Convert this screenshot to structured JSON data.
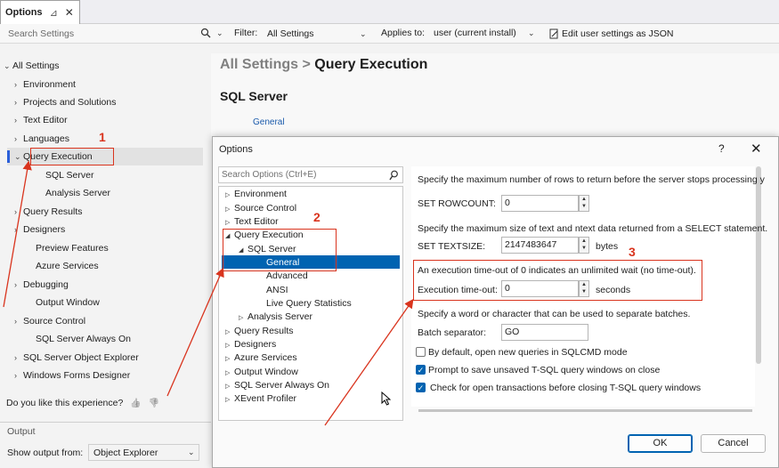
{
  "tab": {
    "title": "Options",
    "pin": "⊿",
    "close": "✕"
  },
  "toolbar": {
    "search_placeholder": "Search Settings",
    "filter_label": "Filter:",
    "filter_value": "All Settings",
    "applies_label": "Applies to:",
    "applies_value": "user (current install)",
    "json_button": "Edit user settings as JSON"
  },
  "left_tree": [
    {
      "label": "All Settings",
      "arrow": "⌄"
    },
    {
      "label": "Environment",
      "arrow": "›"
    },
    {
      "label": "Projects and Solutions",
      "arrow": "›"
    },
    {
      "label": "Text Editor",
      "arrow": "›"
    },
    {
      "label": "Languages",
      "arrow": "›"
    },
    {
      "label": "Query Execution",
      "arrow": "⌄"
    },
    {
      "label": "SQL Server",
      "arrow": ""
    },
    {
      "label": "Analysis Server",
      "arrow": ""
    },
    {
      "label": "Query Results",
      "arrow": "›"
    },
    {
      "label": "Designers",
      "arrow": "›"
    },
    {
      "label": "Preview Features",
      "arrow": ""
    },
    {
      "label": "Azure Services",
      "arrow": ""
    },
    {
      "label": "Debugging",
      "arrow": "›"
    },
    {
      "label": "Output Window",
      "arrow": ""
    },
    {
      "label": "Source Control",
      "arrow": "›"
    },
    {
      "label": "SQL Server Always On",
      "arrow": ""
    },
    {
      "label": "SQL Server Object Explorer",
      "arrow": "›"
    },
    {
      "label": "Windows Forms Designer",
      "arrow": "›"
    }
  ],
  "feedback": {
    "question": "Do you like this experience?",
    "up": "👍",
    "down": "👎"
  },
  "output_panel": {
    "title": "Output",
    "show_from_label": "Show output from:",
    "show_from_value": "Object Explorer"
  },
  "breadcrumb": {
    "root": "All Settings",
    "sep": ">",
    "current": "Query Execution"
  },
  "section_title": "SQL Server",
  "section_link": "General",
  "dialog": {
    "title": "Options",
    "help": "?",
    "close": "✕",
    "search_placeholder": "Search Options (Ctrl+E)",
    "tree": [
      {
        "label": "Environment",
        "arrow": "▷"
      },
      {
        "label": "Source Control",
        "arrow": "▷"
      },
      {
        "label": "Text Editor",
        "arrow": "▷"
      },
      {
        "label": "Query Execution",
        "arrow": "◢"
      },
      {
        "label": "SQL Server",
        "arrow": "◢"
      },
      {
        "label": "General",
        "arrow": ""
      },
      {
        "label": "Advanced",
        "arrow": ""
      },
      {
        "label": "ANSI",
        "arrow": ""
      },
      {
        "label": "Live Query Statistics",
        "arrow": ""
      },
      {
        "label": "Analysis Server",
        "arrow": "▷"
      },
      {
        "label": "Query Results",
        "arrow": "▷"
      },
      {
        "label": "Designers",
        "arrow": "▷"
      },
      {
        "label": "Azure Services",
        "arrow": "▷"
      },
      {
        "label": "Output Window",
        "arrow": "▷"
      },
      {
        "label": "SQL Server Always On",
        "arrow": "▷"
      },
      {
        "label": "XEvent Profiler",
        "arrow": "▷"
      }
    ],
    "rowcount_desc": "Specify the maximum number of rows to return before the server stops processing y",
    "rowcount_label": "SET ROWCOUNT:",
    "rowcount_value": "0",
    "textsize_desc": "Specify the maximum size of text and ntext data returned from a SELECT statement.",
    "textsize_label": "SET TEXTSIZE:",
    "textsize_value": "2147483647",
    "textsize_unit": "bytes",
    "timeout_desc": "An execution time-out of 0 indicates an unlimited wait (no time-out).",
    "timeout_label": "Execution time-out:",
    "timeout_value": "0",
    "timeout_unit": "seconds",
    "batch_desc": "Specify a word or character that can be used to separate batches.",
    "batch_label": "Batch separator:",
    "batch_value": "GO",
    "chk_sqlcmd": "By default, open new queries in SQLCMD mode",
    "chk_prompt": "Prompt to save unsaved T-SQL query windows on close",
    "chk_transactions": "Check for open transactions before closing T-SQL query windows",
    "ok": "OK",
    "cancel": "Cancel"
  },
  "annotations": {
    "n1": "1",
    "n2": "2",
    "n3": "3"
  },
  "accent_color": "#0063b1",
  "annotation_color": "#d9341e"
}
